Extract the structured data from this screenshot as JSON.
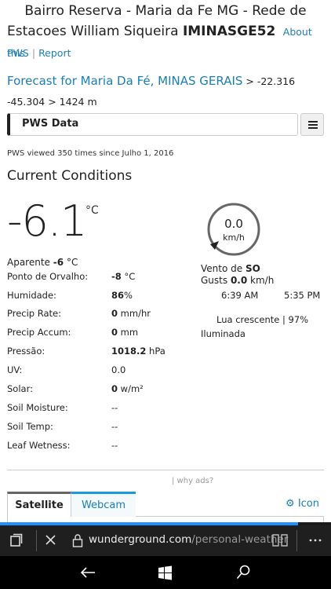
{
  "station": {
    "title_line1": "Bairro Reserva - Maria da Fe MG - Rede de",
    "title_line2": "Estacoes William Siqueira",
    "station_id": "IMINASGE52",
    "about_link": "About this"
  },
  "links": {
    "pws": "PWS",
    "report": "Report"
  },
  "forecast": {
    "link": "Forecast for Maria Da Fé, MINAS GERAIS",
    "coords": "> -22.316",
    "coords2": "-45.304 > 1424 m"
  },
  "pws_bar": {
    "label": "PWS Data"
  },
  "viewed_text": "PWS viewed 350 times since Julho 1, 2016",
  "conditions": {
    "title": "Current Conditions",
    "temperature": "-6.1",
    "temp_unit": "°C",
    "feels_like_label": "Aparente",
    "feels_like_value": "-6",
    "feels_like_unit": "°C"
  },
  "wind": {
    "speed": "0.0",
    "unit": "km/h",
    "direction_label": "Vento de",
    "direction": "SO",
    "gusts_label": "Gusts",
    "gusts_value": "0.0",
    "gusts_unit": "km/h",
    "sunrise": "6:39 AM",
    "sunset": "5:35 PM",
    "moon_line1": "Lua crescente | 97%",
    "moon_line2": "Iluminada"
  },
  "rows": [
    {
      "label": "Ponto de Orvalho:",
      "value": "-8",
      "unit": "°C"
    },
    {
      "label": "Humidade:",
      "value": "86",
      "unit": "%"
    },
    {
      "label": "Precip Rate:",
      "value": "0",
      "unit": "mm/hr"
    },
    {
      "label": "Precip Accum:",
      "value": "0",
      "unit": "mm"
    },
    {
      "label": "Pressão:",
      "value": "1018.2",
      "unit": "hPa"
    },
    {
      "label": "UV:",
      "value": "0.0",
      "unit": ""
    },
    {
      "label": "Solar:",
      "value": "0",
      "unit": "w/m²"
    },
    {
      "label": "Soil Moisture:",
      "value": "--",
      "unit": ""
    },
    {
      "label": "Soil Temp:",
      "value": "--",
      "unit": ""
    },
    {
      "label": "Leaf Wetness:",
      "value": "--",
      "unit": ""
    }
  ],
  "ads": {
    "why": "| why ads?"
  },
  "tabs": {
    "satellite": "Satellite",
    "webcam": "Webcam",
    "icon": "Icon"
  },
  "browser": {
    "url_host": "wunderground.com",
    "url_path": "/personal-weather",
    "load_progress": 0.9
  },
  "colors": {
    "link": "#1a7fb5",
    "progress": "#1e90ff",
    "chrome": "#1f1f1f"
  }
}
